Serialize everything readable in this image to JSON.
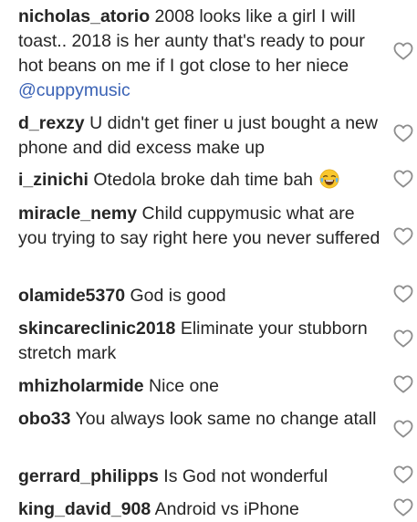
{
  "comments": [
    {
      "username": "nicholas_atorio",
      "text": "2008 looks like a girl I will toast.. 2018 is her aunty that's ready to pour hot beans on me if I got close to her niece",
      "mention": "@cuppymusic"
    },
    {
      "username": "d_rexzy",
      "text": "U didn't get finer u just bought a new phone and did excess make up"
    },
    {
      "username": "i_zinichi",
      "text": "Otedola broke dah time bah",
      "emoji": "face-with-tears-of-joy"
    },
    {
      "username": "miracle_nemy",
      "text": "Child cuppymusic what are you trying to say right here you never suffered"
    },
    {
      "username": "olamide5370",
      "text": "God is good"
    },
    {
      "username": "skincareclinic2018",
      "text": "Eliminate your stubborn stretch mark"
    },
    {
      "username": "mhizholarmide",
      "text": "Nice one"
    },
    {
      "username": "obo33",
      "text": "You always look same no change atall"
    },
    {
      "username": "gerrard_philipps",
      "text": "Is God not wonderful"
    },
    {
      "username": "king_david_908",
      "text": "Android vs iPhone"
    }
  ],
  "icons": {
    "like": "heart-outline-icon"
  },
  "colors": {
    "text": "#262626",
    "mention": "#3a62b5",
    "heart_stroke": "#8e8e8e"
  }
}
